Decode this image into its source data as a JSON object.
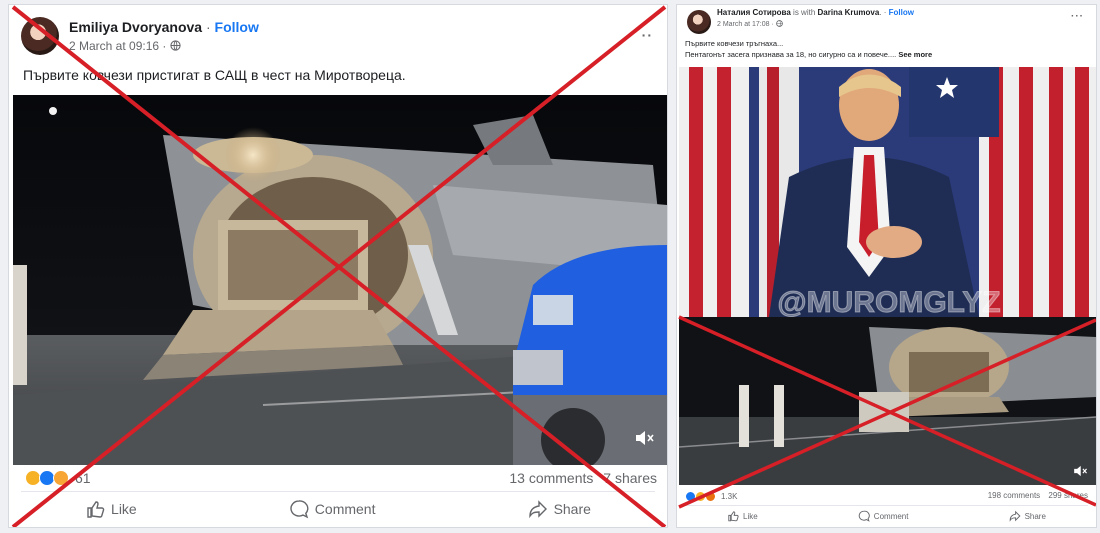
{
  "post_left": {
    "author": "Emiliya Dvoryanova",
    "separator": " · ",
    "follow": "Follow",
    "timestamp": "2 March at 09:16 ·",
    "caption": "Първите ковчези пристигат в САЩ в чест на Миротвореца.",
    "reactions_count": "61",
    "comments": "13 comments",
    "shares": "7 shares",
    "actions": {
      "like": "Like",
      "comment": "Comment",
      "share": "Share"
    }
  },
  "post_right": {
    "author": "Наталия Сотирова",
    "with_text": " is with ",
    "tagged": "Darina Krumova",
    "separator": ". · ",
    "follow": "Follow",
    "timestamp": "2 March at 17:08 ·",
    "caption_line1": "Първите ковчези тръгнаха...",
    "caption_line2": "Пентагонът засега признава за 18, но сигурно са и повече....",
    "see_more": " See more",
    "watermark": "@MUROMGLYZ",
    "reactions_count": "1.3K",
    "comments": "198 comments",
    "shares": "299 shares",
    "actions": {
      "like": "Like",
      "comment": "Comment",
      "share": "Share"
    }
  },
  "icons": {
    "globe": "globe-icon",
    "like": "thumbs-up-icon",
    "comment": "comment-bubble-icon",
    "share": "share-arrow-icon",
    "mute": "speaker-mute-icon",
    "more": "more-options-icon"
  },
  "colors": {
    "cross": "#d61f26",
    "link": "#1877f2",
    "truck_blue": "#1f5fe0",
    "secondary_text": "#65676b"
  }
}
